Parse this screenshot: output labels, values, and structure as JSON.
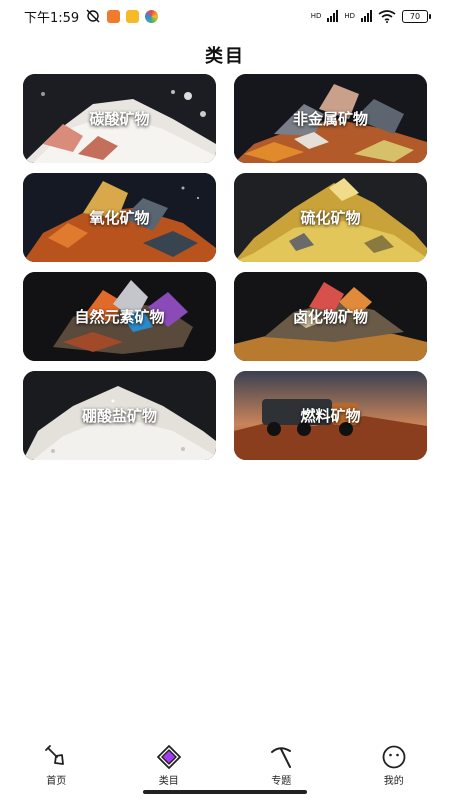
{
  "status_bar": {
    "time": "下午1:59",
    "signal_label_1": "HD",
    "signal_label_2": "HD",
    "battery": "70"
  },
  "page_title": "类目",
  "categories": [
    {
      "label": "碳酸矿物"
    },
    {
      "label": "非金属矿物"
    },
    {
      "label": "氧化矿物"
    },
    {
      "label": "硫化矿物"
    },
    {
      "label": "自然元素矿物"
    },
    {
      "label": "卤化物矿物"
    },
    {
      "label": "硼酸盐矿物"
    },
    {
      "label": "燃料矿物"
    }
  ],
  "bottom_nav": [
    {
      "label": "首页",
      "icon": "shovel-icon",
      "active": false
    },
    {
      "label": "类目",
      "icon": "gem-icon",
      "active": true
    },
    {
      "label": "专题",
      "icon": "pickaxe-icon",
      "active": false
    },
    {
      "label": "我的",
      "icon": "face-icon",
      "active": false
    }
  ],
  "colors": {
    "accent": "#a33cf0",
    "text": "#111111",
    "background": "#ffffff"
  }
}
